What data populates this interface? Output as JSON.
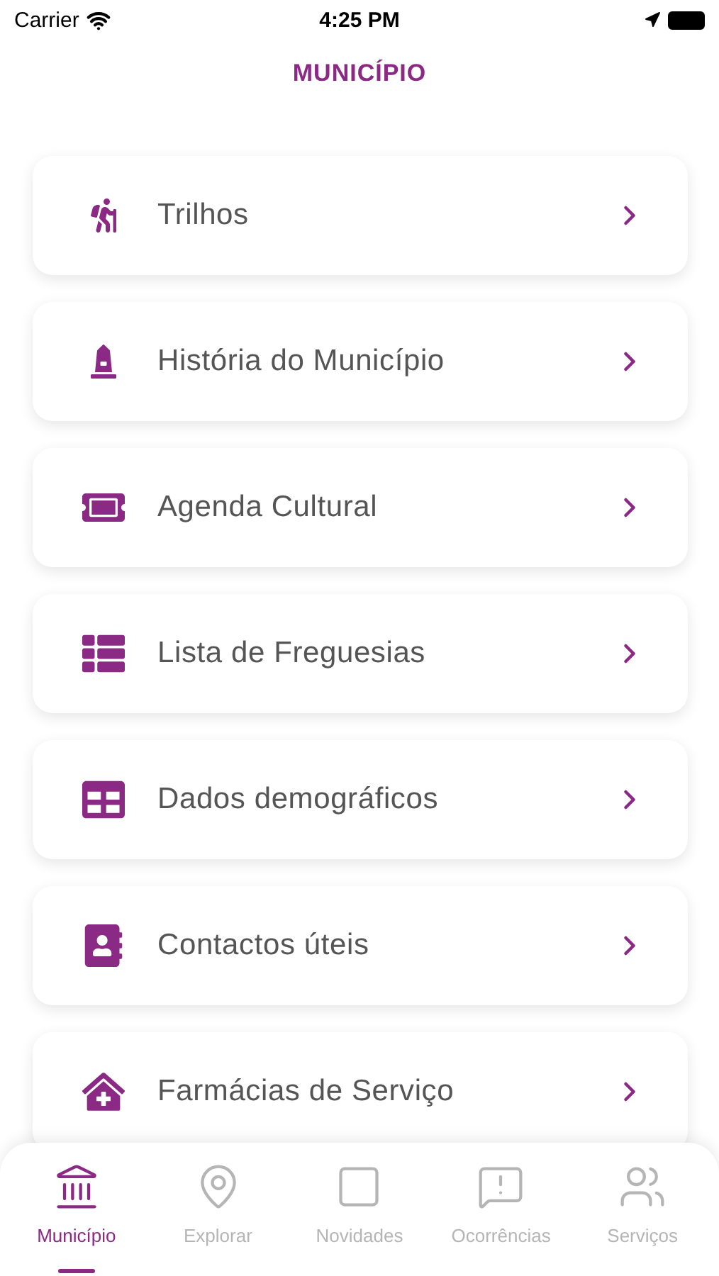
{
  "status_bar": {
    "carrier": "Carrier",
    "time": "4:25 PM"
  },
  "title": "MUNICÍPIO",
  "menu": [
    {
      "label": "Trilhos"
    },
    {
      "label": "História do Município"
    },
    {
      "label": "Agenda Cultural"
    },
    {
      "label": "Lista de Freguesias"
    },
    {
      "label": "Dados demográficos"
    },
    {
      "label": "Contactos úteis"
    },
    {
      "label": "Farmácias de Serviço"
    }
  ],
  "tab_bar": [
    {
      "label": "Município",
      "selected": true
    },
    {
      "label": "Explorar",
      "selected": false
    },
    {
      "label": "Novidades",
      "selected": false
    },
    {
      "label": "Ocorrências",
      "selected": false
    },
    {
      "label": "Serviços",
      "selected": false
    }
  ]
}
